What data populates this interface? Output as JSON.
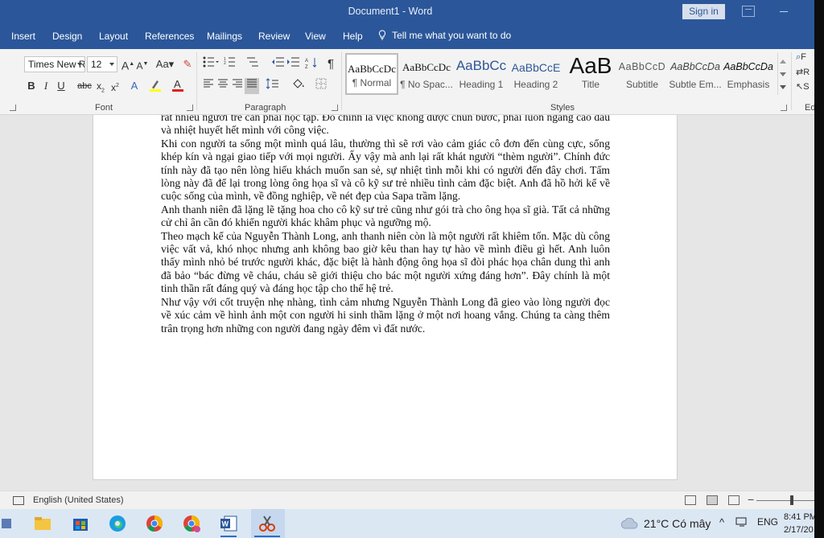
{
  "window": {
    "title": "Document1 - Word",
    "sign_in": "Sign in"
  },
  "tabs": [
    "Insert",
    "Design",
    "Layout",
    "References",
    "Mailings",
    "Review",
    "View",
    "Help"
  ],
  "tell_me": "Tell me what you want to do",
  "font": {
    "name": "Times New R",
    "size": "12",
    "group_label": "Font"
  },
  "paragraph": {
    "group_label": "Paragraph"
  },
  "styles": {
    "group_label": "Styles",
    "items": [
      {
        "sample": "AaBbCcDc",
        "name": "¶ Normal"
      },
      {
        "sample": "AaBbCcDc",
        "name": "¶ No Spac..."
      },
      {
        "sample": "AaBbCc",
        "name": "Heading 1"
      },
      {
        "sample": "AaBbCcE",
        "name": "Heading 2"
      },
      {
        "sample": "AaB",
        "name": "Title"
      },
      {
        "sample": "AaBbCcD",
        "name": "Subtitle"
      },
      {
        "sample": "AaBbCcDa",
        "name": "Subtle Em..."
      },
      {
        "sample": "AaBbCcDa",
        "name": "Emphasis"
      }
    ]
  },
  "editing": {
    "label_partial": "Ed",
    "find": "F",
    "replace": "R",
    "select": "S"
  },
  "document": {
    "paragraphs": [
      "rất nhiều người trẻ cần phải học tập. Đó chính là việc không được chùn bước, phải luôn ngẩng cao đầu và nhiệt huyết hết mình với công việc.",
      "Khi con người ta sống một mình quá lâu, thường thì sẽ rơi vào cảm giác cô đơn đến cùng cực, sống khép kín và ngại giao tiếp với mọi người. Ấy vậy mà anh lại rất khát người “thèm người”. Chính đức tính này đã tạo nên lòng hiếu khách muốn san sẻ, sự nhiệt tình mỗi khi có người đến đây chơi. Tấm lòng này đã để lại trong lòng ông họa sĩ và cô kỹ sư trẻ nhiều tình cảm đặc biệt. Anh đã hồ hởi kể về cuộc sống của mình, về đồng nghiệp, về nét đẹp của Sapa trầm lặng.",
      "Anh thanh niên đã lặng lẽ tặng hoa cho cô kỹ sư trẻ cũng như gói trà cho ông họa sĩ già. Tất cả những cử chỉ ân cần đó khiến người khác khâm phục và ngưỡng mộ.",
      "Theo mạch kể của Nguyễn Thành Long, anh thanh niên còn là một người rất khiêm tốn. Mặc dù công việc vất vả, khó nhọc nhưng anh không bao giờ kêu than hay tự hào về mình điều gì hết. Anh luôn thấy mình nhỏ bé trước người khác, đặc biệt là hành động ông họa sĩ đòi phác họa chân dung thì anh đã bảo “bác đừng vẽ cháu, cháu sẽ giới thiệu cho bác một người xứng đáng hơn”. Đây chính là một tinh thần rất đáng quý và đáng học tập cho thế hệ trẻ.",
      "Như vậy với cốt truyện nhẹ nhàng, tình cảm nhưng Nguyễn Thành Long đã gieo vào lòng người đọc về xúc cảm về hình ảnh một con người hi sinh thầm lặng ở một nơi hoang vắng. Chúng ta càng thêm trân trọng hơn những con người đang ngày đêm vì đất nước."
    ]
  },
  "status": {
    "language": "English (United States)"
  },
  "taskbar": {
    "weather": "21°C  Có mây",
    "input_lang": "ENG",
    "time": "8:41 PM",
    "date": "2/17/20"
  },
  "colors": {
    "word_blue": "#2b579a",
    "highlight_yellow": "#ffff00",
    "font_color_red": "#e02020"
  }
}
